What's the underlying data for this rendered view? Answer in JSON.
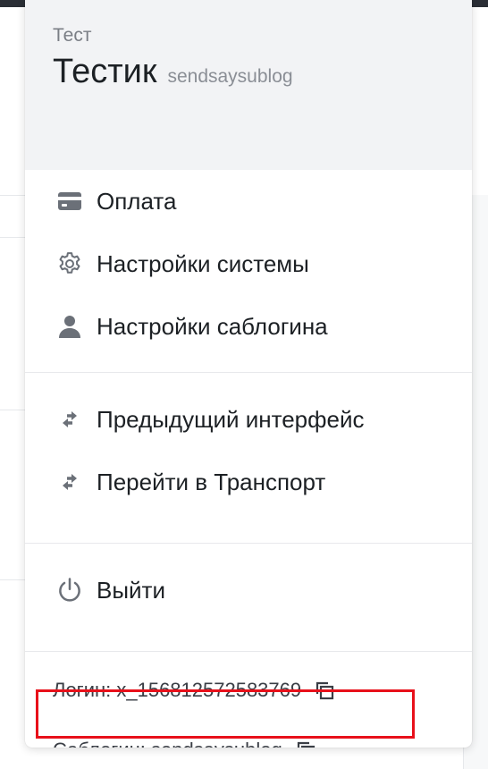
{
  "account": {
    "org_name": "Тест",
    "user_name": "Тестик",
    "user_login": "sendsaysublog"
  },
  "menu": {
    "billing": {
      "label": "Оплата",
      "icon": "credit-card-icon"
    },
    "system_settings": {
      "label": "Настройки системы",
      "icon": "gear-icon"
    },
    "sublogin_settings": {
      "label": "Настройки саблогина",
      "icon": "person-icon"
    },
    "previous_interface": {
      "label": "Предыдущий интерфейс",
      "icon": "swap-arrows-icon"
    },
    "go_transport": {
      "label": "Перейти в Транспорт",
      "icon": "swap-arrows-icon"
    },
    "logout": {
      "label": "Выйти",
      "icon": "power-icon"
    }
  },
  "footer": {
    "login": "Логин: x_156812572583769",
    "sublogin": "Саблогин: sendsaysublog"
  },
  "colors": {
    "highlight": "#e8101a",
    "icon": "#6b7078",
    "header_bg": "#f2f3f5"
  }
}
